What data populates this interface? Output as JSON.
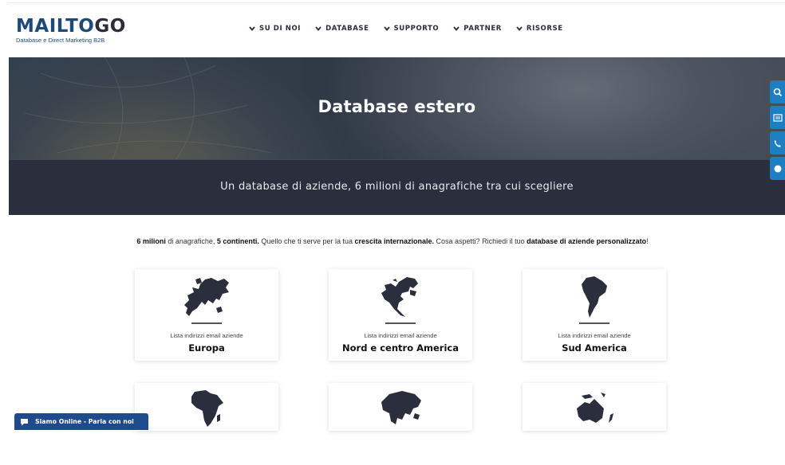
{
  "brand": {
    "logo_main": "MAILTO",
    "logo_go": "GO",
    "tagline": "Database e Direct Marketing B2B",
    "accent": "#1e4a7a"
  },
  "nav": {
    "items": [
      {
        "label": "SU DI NOI",
        "icon": "chevron-down-icon"
      },
      {
        "label": "DATABASE",
        "icon": "chevron-down-icon"
      },
      {
        "label": "SUPPORTO",
        "icon": "chevron-down-icon"
      },
      {
        "label": "PARTNER",
        "icon": "chevron-down-icon"
      },
      {
        "label": "RISORSE",
        "icon": "chevron-down-icon"
      }
    ]
  },
  "hero": {
    "title": "Database estero",
    "subtitle": "Un database di aziende, 6 milioni di anagrafiche tra cui scegliere"
  },
  "side_buttons": [
    "search-icon",
    "newsletter-icon",
    "phone-icon",
    "chat-icon"
  ],
  "intro": {
    "p1": "6 milioni",
    "p2": " di anagrafiche, ",
    "p3": "5 continenti.",
    "p4": " Quello che ti serve per la tua ",
    "p5": "crescita internazionale.",
    "p6": " Cosa aspetti? Richiedi il tuo ",
    "p7": "database di aziende personalizzato",
    "p8": "!"
  },
  "cards": [
    {
      "subtitle": "Lista indirizzi email aziende",
      "name": "Europa",
      "icon": "europe-map-icon"
    },
    {
      "subtitle": "Lista indirizzi email aziende",
      "name": "Nord e centro America",
      "icon": "north-america-map-icon"
    },
    {
      "subtitle": "Lista indirizzi email aziende",
      "name": "Sud America",
      "icon": "south-america-map-icon"
    },
    {
      "icon": "africa-map-icon"
    },
    {
      "icon": "asia-map-icon"
    },
    {
      "icon": "oceania-map-icon"
    }
  ],
  "chat": {
    "label": "Siamo Online - Parla con noi"
  },
  "colors": {
    "dark": "#2b2e3c",
    "side_blue": "#1d7fc2",
    "chat_blue": "#1f4a8c"
  }
}
